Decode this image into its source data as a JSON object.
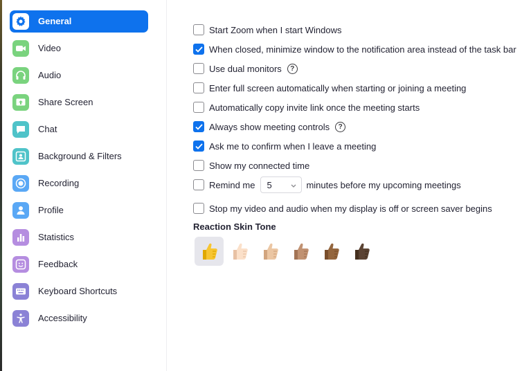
{
  "sidebar": {
    "items": [
      {
        "label": "General",
        "icon": "gear-icon",
        "color": "#ffffff",
        "active": true
      },
      {
        "label": "Video",
        "icon": "video-icon",
        "color": "#7ad37e"
      },
      {
        "label": "Audio",
        "icon": "headphones-icon",
        "color": "#7ad37e"
      },
      {
        "label": "Share Screen",
        "icon": "share-screen-icon",
        "color": "#7ad37e"
      },
      {
        "label": "Chat",
        "icon": "chat-icon",
        "color": "#4fc3c9"
      },
      {
        "label": "Background & Filters",
        "icon": "person-frame-icon",
        "color": "#4fc3c9"
      },
      {
        "label": "Recording",
        "icon": "record-icon",
        "color": "#5aa8f5"
      },
      {
        "label": "Profile",
        "icon": "profile-icon",
        "color": "#5aa8f5"
      },
      {
        "label": "Statistics",
        "icon": "bar-chart-icon",
        "color": "#b58de0"
      },
      {
        "label": "Feedback",
        "icon": "smiley-icon",
        "color": "#b58de0"
      },
      {
        "label": "Keyboard Shortcuts",
        "icon": "keyboard-icon",
        "color": "#8b82d6"
      },
      {
        "label": "Accessibility",
        "icon": "accessibility-icon",
        "color": "#8b82d6"
      }
    ]
  },
  "options": [
    {
      "label": "Start Zoom when I start Windows",
      "checked": false
    },
    {
      "label": "When closed, minimize window to the notification area instead of the task bar",
      "checked": true
    },
    {
      "label": "Use dual monitors",
      "checked": false,
      "help": true
    },
    {
      "label": "Enter full screen automatically when starting or joining a meeting",
      "checked": false
    },
    {
      "label": "Automatically copy invite link once the meeting starts",
      "checked": false
    },
    {
      "label": "Always show meeting controls",
      "checked": true,
      "help": true
    },
    {
      "label": "Ask me to confirm when I leave a meeting",
      "checked": true
    },
    {
      "label": "Show my connected time",
      "checked": false
    },
    {
      "label": "Remind me",
      "checked": false,
      "select_value": "5",
      "after": "minutes before my upcoming meetings"
    },
    {
      "label": "Stop my video and audio when my display is off or screen saver begins",
      "checked": false
    }
  ],
  "help_glyph": "?",
  "reaction": {
    "title": "Reaction Skin Tone",
    "tones": [
      {
        "name": "default",
        "color": "#f7c531",
        "shade": "#e0a800",
        "selected": true
      },
      {
        "name": "light",
        "color": "#fbe0c9",
        "shade": "#e8c1a4"
      },
      {
        "name": "medium-light",
        "color": "#ebc6a3",
        "shade": "#d2a57f"
      },
      {
        "name": "medium",
        "color": "#c19272",
        "shade": "#a37455"
      },
      {
        "name": "medium-dark",
        "color": "#94663e",
        "shade": "#7a4f2c"
      },
      {
        "name": "dark",
        "color": "#5b4333",
        "shade": "#45301f"
      }
    ]
  },
  "colors": {
    "accent": "#0e72ed"
  }
}
